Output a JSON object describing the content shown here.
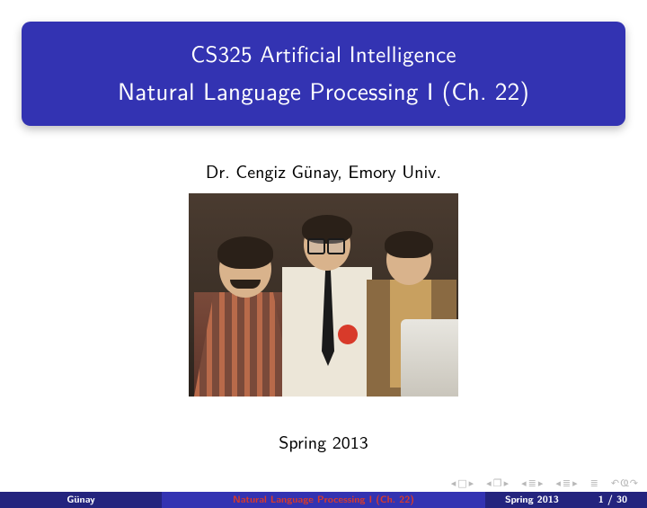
{
  "title": {
    "line1": "CS325 Artificial Intelligence",
    "line2": "Natural Language Processing I (Ch. 22)"
  },
  "author": "Dr. Cengiz Günay, Emory Univ.",
  "date": "Spring 2013",
  "footline": {
    "author_short": "Günay",
    "title_short": "Natural Language Processing I (Ch. 22)",
    "date_short": "Spring 2013",
    "page_current": "1",
    "page_total": "30"
  },
  "nav_icons": {
    "first": "◂ □ ▸",
    "prev_section": "◂ 🗇 ▸",
    "prev_subsection": "◂ ≡ ▸",
    "next_subsection": "◂ ≡ ▸",
    "appendix": "≡",
    "back_symbol": "↰",
    "quit": "✧"
  }
}
